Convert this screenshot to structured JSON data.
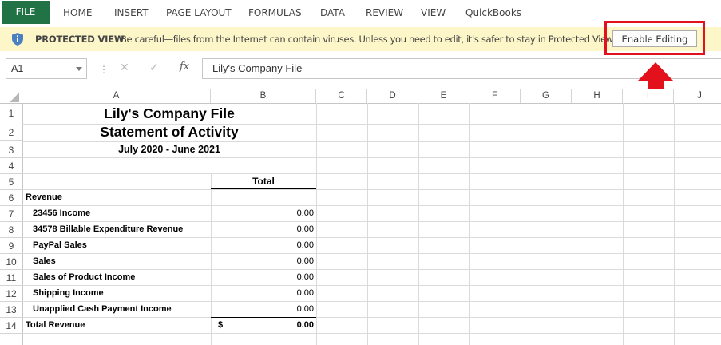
{
  "ribbon": {
    "tabs": [
      "FILE",
      "HOME",
      "INSERT",
      "PAGE LAYOUT",
      "FORMULAS",
      "DATA",
      "REVIEW",
      "VIEW",
      "QuickBooks"
    ]
  },
  "protected_view": {
    "title": "PROTECTED VIEW",
    "message": "Be careful—files from the Internet can contain viruses. Unless you need to edit, it's safer to stay in Protected View.",
    "enable_label": "Enable Editing",
    "icon": "shield-icon",
    "highlight_color": "#e2111b"
  },
  "formula_bar": {
    "name_box": "A1",
    "fx_label": "fx",
    "content": "Lily's Company File"
  },
  "columns": [
    "A",
    "B",
    "C",
    "D",
    "E",
    "F",
    "G",
    "H",
    "I",
    "J"
  ],
  "rows": [
    "1",
    "2",
    "3",
    "4",
    "5",
    "6",
    "7",
    "8",
    "9",
    "10",
    "11",
    "12",
    "13",
    "14"
  ],
  "sheet": {
    "company": "Lily's Company File",
    "report": "Statement of Activity",
    "period": "July 2020 - June 2021",
    "total_header": "Total",
    "revenue_label": "Revenue",
    "items": [
      {
        "label": "23456 Income",
        "value": "0.00"
      },
      {
        "label": "34578 Billable Expenditure Revenue",
        "value": "0.00"
      },
      {
        "label": "PayPal Sales",
        "value": "0.00"
      },
      {
        "label": "Sales",
        "value": "0.00"
      },
      {
        "label": "Sales of Product Income",
        "value": "0.00"
      },
      {
        "label": "Shipping Income",
        "value": "0.00"
      },
      {
        "label": "Unapplied Cash Payment Income",
        "value": "0.00"
      }
    ],
    "total_revenue_label": "Total Revenue",
    "currency": "$",
    "total_revenue_value": "0.00"
  },
  "colors": {
    "file_tab": "#217346",
    "protected_bar": "#fdf6c9",
    "arrow": "#e2111b"
  }
}
